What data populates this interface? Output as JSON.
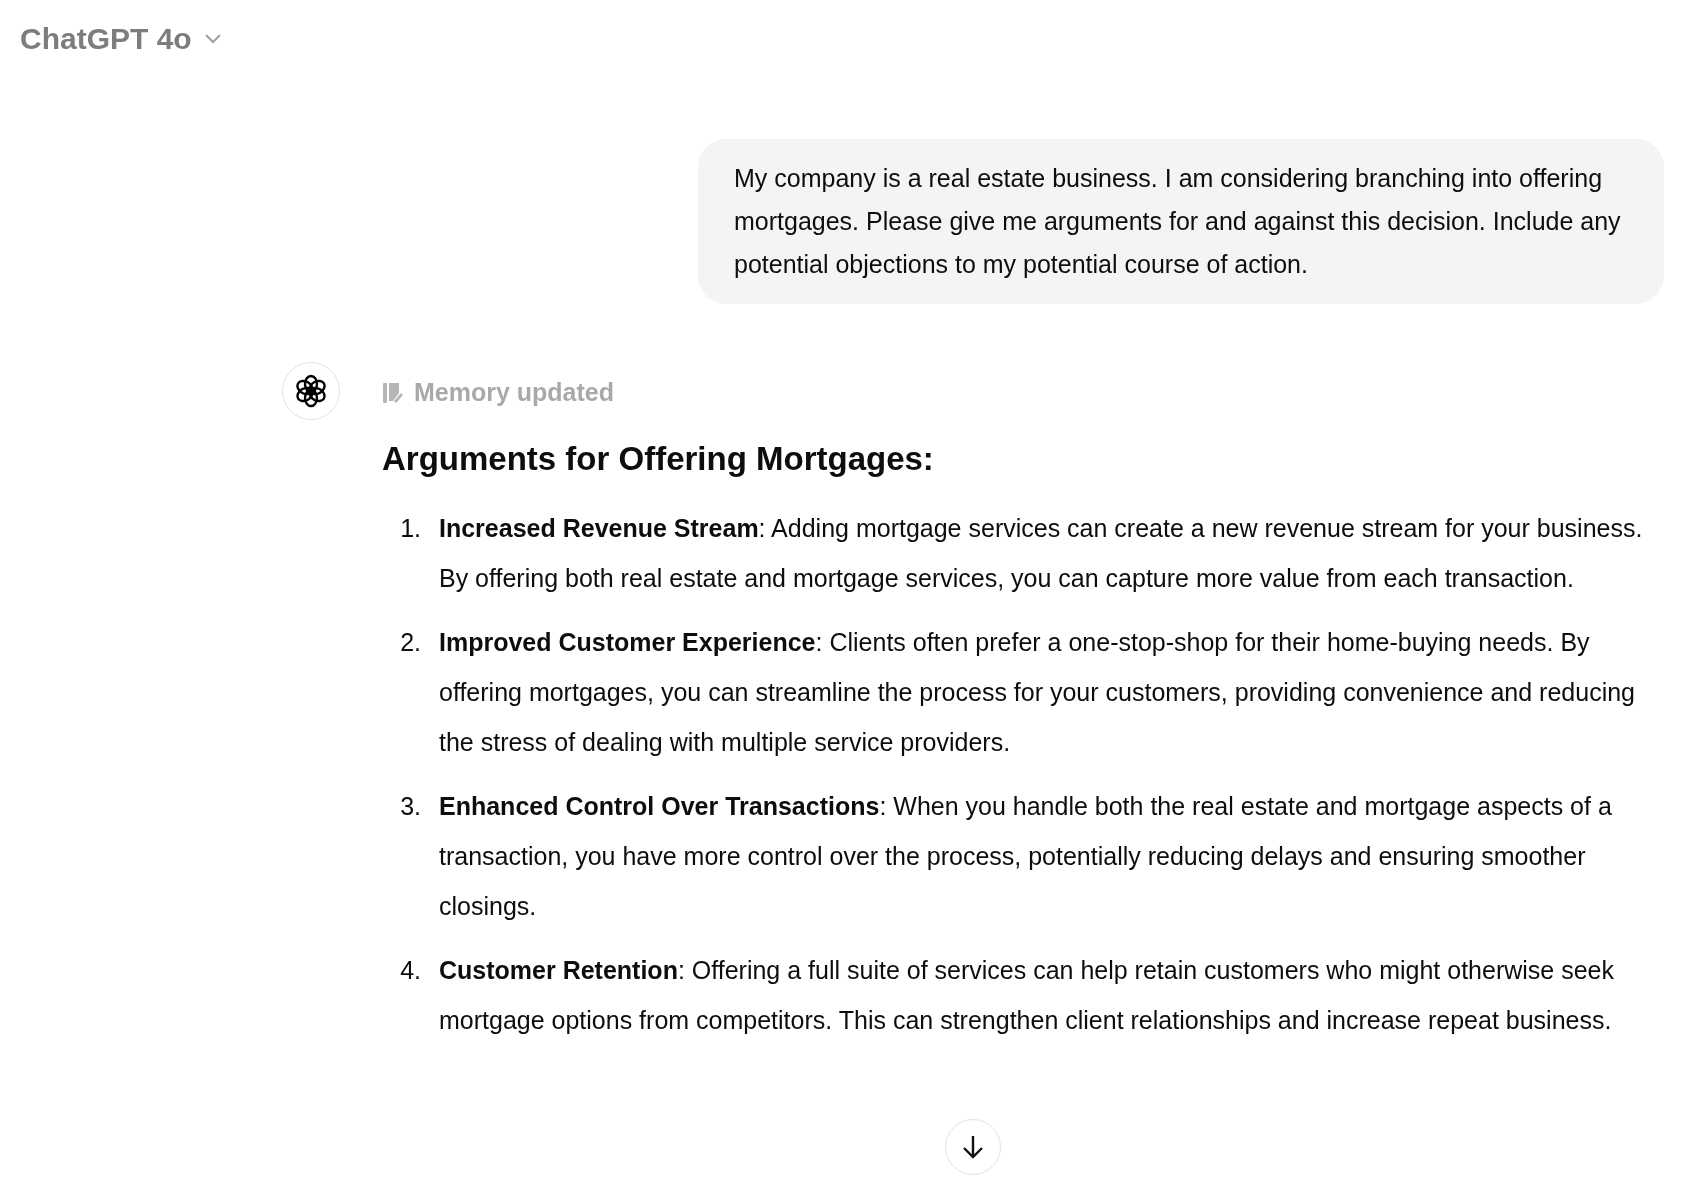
{
  "header": {
    "model_name": "ChatGPT 4o"
  },
  "user_message": "My company is a real estate business. I am considering branching into offering mortgages. Please give me arguments for and against this decision. Include any potential objections to my potential course of action.",
  "assistant": {
    "status": "Memory updated",
    "heading": "Arguments for Offering Mortgages:",
    "items": [
      {
        "number": "1.",
        "text": "**Increased Revenue Stream**: Adding mortgage services can create a new revenue stream for your business. By offering both real estate and mortgage services, you can capture more value from each transaction."
      },
      {
        "number": "2.",
        "text": "**Improved Customer Experience**: Clients often prefer a one-stop-shop for their home-buying needs. By offering mortgages, you can streamline the process for your customers, providing convenience and reducing the stress of dealing with multiple service providers."
      },
      {
        "number": "3.",
        "text": "**Enhanced Control Over Transactions**: When you handle both the real estate and mortgage aspects of a transaction, you have more control over the process, potentially reducing delays and ensuring smoother closings."
      },
      {
        "number": "4.",
        "text": "**Customer Retention**: Offering a full suite of services can help retain customers who might otherwise seek mortgage options from competitors. This can strengthen client relationships and increase repeat business."
      }
    ]
  }
}
